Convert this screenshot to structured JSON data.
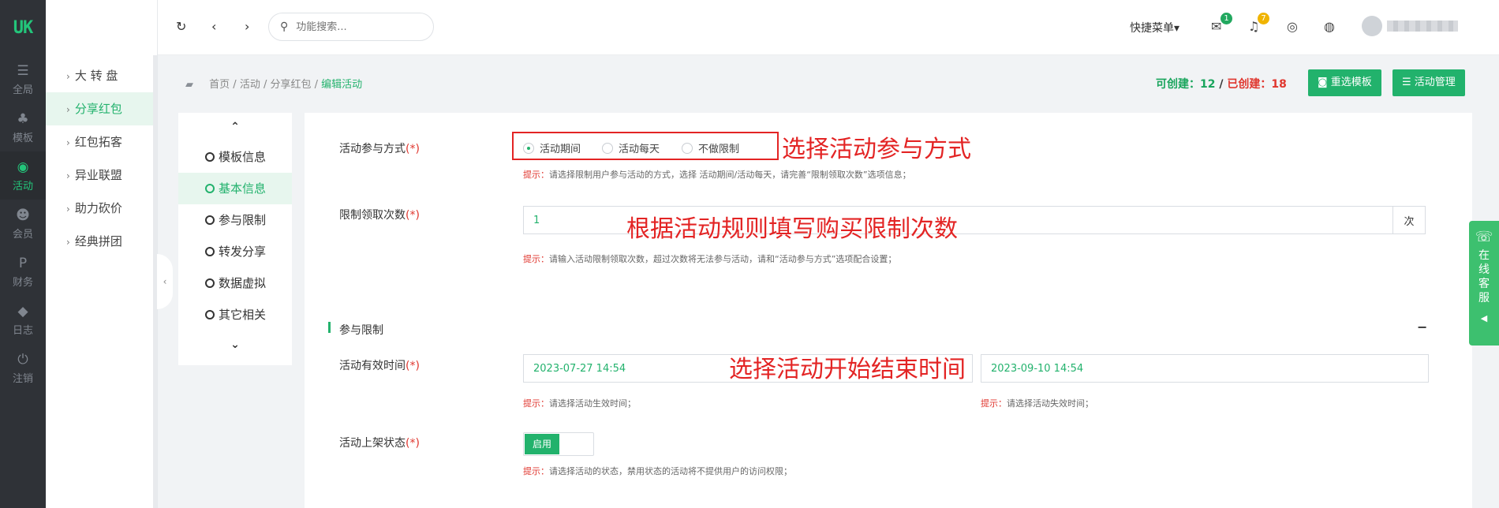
{
  "logo": {
    "text": "UK"
  },
  "rail": [
    {
      "icon": "☰",
      "label": "全局"
    },
    {
      "icon": "♣",
      "label": "模板"
    },
    {
      "icon": "◉",
      "label": "活动"
    },
    {
      "icon": "☻",
      "label": "会员"
    },
    {
      "icon": "P",
      "label": "财务"
    },
    {
      "icon": "◆",
      "label": "日志"
    },
    {
      "icon": "⏻",
      "label": "注销"
    }
  ],
  "submenu": [
    "大 转 盘",
    "分享红包",
    "红包拓客",
    "异业联盟",
    "助力砍价",
    "经典拼团"
  ],
  "topbar": {
    "search_placeholder": "功能搜索...",
    "quick_menu": "快捷菜单▾",
    "msg_count": "1",
    "notify_count": "7",
    "colors": {
      "accent": "#23b26d",
      "badge_green": "#22a85f",
      "badge_yellow": "#f0b400"
    }
  },
  "breadcrumb": {
    "parts": [
      "首页",
      "活动",
      "分享红包"
    ],
    "current": "编辑活动"
  },
  "counts": {
    "can_create_label": "可创建：",
    "can_create": "12",
    "created_label": "已创建：",
    "created": "18"
  },
  "buttons": {
    "reselect": "重选模板",
    "manage": "活动管理"
  },
  "steps": [
    "模板信息",
    "基本信息",
    "参与限制",
    "转发分享",
    "数据虚拟",
    "其它相关"
  ],
  "form": {
    "mode_label": "活动参与方式",
    "req": "(*)",
    "mode_options": [
      "活动期间",
      "活动每天",
      "不做限制"
    ],
    "mode_hint_tag": "提示：",
    "mode_hint": "请选择限制用户参与活动的方式，选择 活动期间/活动每天，请完善“限制领取次数”选项信息；",
    "limit_label": "限制领取次数",
    "limit_value": "1",
    "limit_unit": "次",
    "limit_hint": "请输入活动限制领取次数，超过次数将无法参与活动，请和“活动参与方式”选项配合设置；",
    "section_title": "参与限制",
    "section_toggle": "−",
    "time_label": "活动有效时间",
    "start_time": "2023-07-27 14:54",
    "end_time": "2023-09-10 14:54",
    "start_hint": "请选择活动生效时间；",
    "end_hint": "请选择活动失效时间；",
    "status_label": "活动上架状态",
    "status_on": "启用",
    "status_hint": "请选择活动的状态，禁用状态的活动将不提供用户的访问权限；"
  },
  "annotations": [
    "选择活动参与方式",
    "根据活动规则填写购买限制次数",
    "选择活动开始结束时间"
  ],
  "service": {
    "text": "在线客服"
  }
}
